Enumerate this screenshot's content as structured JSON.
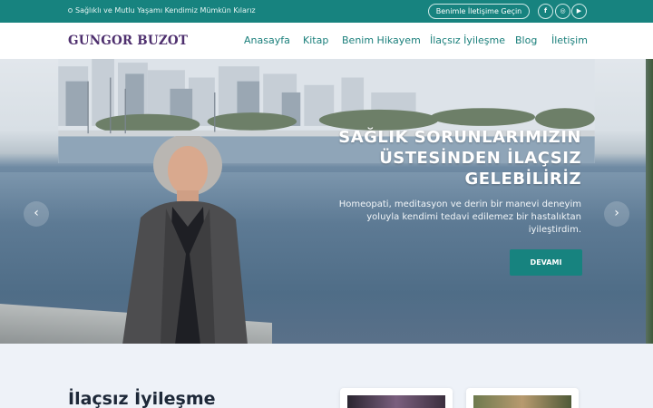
{
  "topbar": {
    "tagline": "Sağlıklı ve Mutlu Yaşamı Kendimiz Mümkün Kılarız",
    "contact_button": "Benimle İletişime Geçin",
    "social": [
      {
        "icon": "facebook-icon",
        "glyph": "f"
      },
      {
        "icon": "instagram-icon",
        "glyph": "◎"
      },
      {
        "icon": "youtube-icon",
        "glyph": "▶"
      }
    ]
  },
  "header": {
    "logo": "GUNGOR BUZOT",
    "nav": [
      "Anasayfa",
      "Kitap",
      "Benim Hikayem",
      "İlaçsız İyileşme",
      "Blog",
      "İletişim"
    ]
  },
  "hero": {
    "title_lines": [
      "SAĞLIK SORUNLARIMIZIN",
      "ÜSTESİNDEN İLAÇSIZ",
      "GELEBİLİRİZ"
    ],
    "subtitle_lines": [
      "Homeopati, meditasyon ve derin bir manevi deneyim",
      "yoluyla kendimi tedavi edilemez bir hastalıktan",
      "iyileştirdim."
    ],
    "button": "DEVAMI",
    "prev_arrow": "‹",
    "next_arrow": "›"
  },
  "section": {
    "title": "İlaçsız İyileşme"
  },
  "colors": {
    "brand_teal": "#17837f",
    "logo_purple": "#4e2f6e",
    "heading_dark": "#1d2838"
  }
}
